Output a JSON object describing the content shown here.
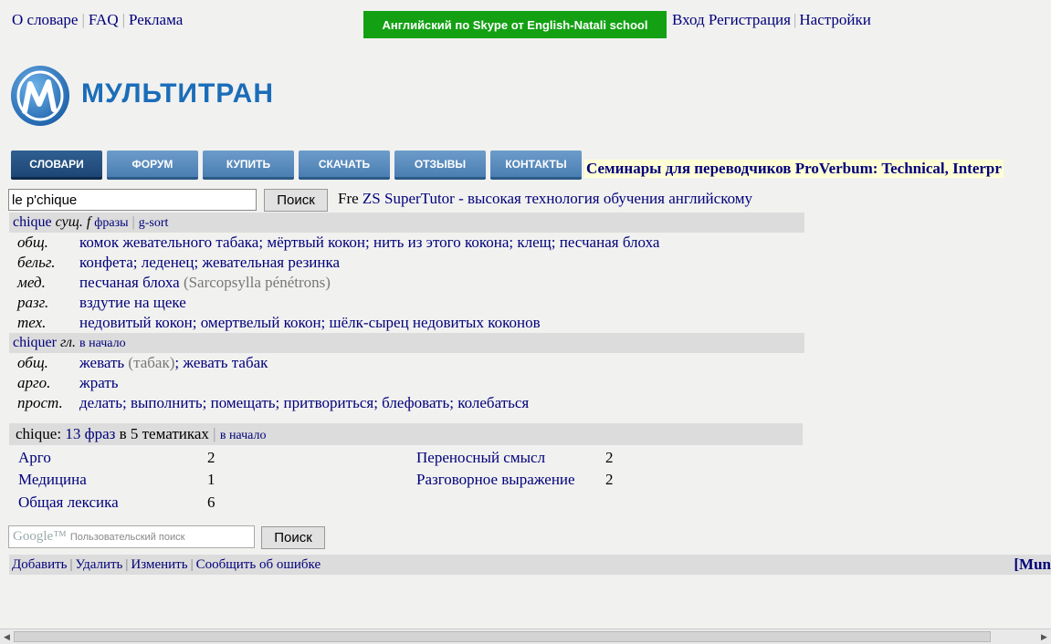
{
  "top_links": [
    "О словаре",
    "FAQ",
    "Реклама"
  ],
  "ad_banner": "Английский по Skype от English-Natali school",
  "account_links": [
    "Вход",
    "Регистрация",
    "Настройки"
  ],
  "logo_text": "МУЛЬТИТРАН",
  "nav": [
    "СЛОВАРИ",
    "ФОРУМ",
    "КУПИТЬ",
    "СКАЧАТЬ",
    "ОТЗЫВЫ",
    "КОНТАКТЫ"
  ],
  "seminar_text": "Семинары для переводчиков ProVerbum: Technical, Interpr",
  "search": {
    "value": "le p'chique",
    "button": "Поиск"
  },
  "promo": {
    "lang": "Fre",
    "text": "ZS SuperTutor - высокая технология обучения английскому"
  },
  "entries": [
    {
      "word": "chique",
      "pos": "сущ.",
      "gender": "f",
      "links": [
        "фразы",
        "g-sort"
      ],
      "rows": [
        {
          "subject": "общ.",
          "text": "комок жевательного табака; мёртвый кокон; нить из этого кокона; клещ; песчаная блоха",
          "note": ""
        },
        {
          "subject": "бельг.",
          "text": "конфета; леденец; жевательная резинка",
          "note": ""
        },
        {
          "subject": "мед.",
          "text": "песчаная блоха",
          "note": "(Sarcopsylla pénétrons)"
        },
        {
          "subject": "разг.",
          "text": "вздутие на щеке",
          "note": ""
        },
        {
          "subject": "тех.",
          "text": "недовитый кокон; омертвелый кокон; шёлк-сырец недовитых коконов",
          "note": ""
        }
      ]
    },
    {
      "word": "chiquer",
      "pos": "гл.",
      "gender": "",
      "links": [
        "в начало"
      ],
      "rows": [
        {
          "subject": "общ.",
          "text_a": "жевать",
          "note": "(табак)",
          "text_b": "; жевать табак"
        },
        {
          "subject": "арго.",
          "text": "жрать",
          "note": ""
        },
        {
          "subject": "прост.",
          "text": "делать; выполнить; помещать; притвориться; блефовать; колебаться",
          "note": ""
        }
      ]
    }
  ],
  "summary": {
    "word": "chique",
    "phrases_link": "13 фраз",
    "rest": "в 5 тематиках",
    "top_link": "в начало"
  },
  "topics": [
    {
      "name": "Арго",
      "count": "2"
    },
    {
      "name": "Медицина",
      "count": "1"
    },
    {
      "name": "Общая лексика",
      "count": "6"
    },
    {
      "name": "Переносный смысл",
      "count": "2"
    },
    {
      "name": "Разговорное выражение",
      "count": "2"
    }
  ],
  "google": {
    "logo": "Google™",
    "placeholder": "Пользовательский поиск",
    "button": "Поиск"
  },
  "footer": {
    "links": [
      "Добавить",
      "Удалить",
      "Изменить",
      "Сообщить об ошибке"
    ],
    "right": "[Mun"
  },
  "colors": {
    "link": "#00007a",
    "ad_green": "#13a113",
    "nav_blue": "#4a7eb3",
    "logo_blue": "#1b6db8",
    "row_gray": "#dcdcdc"
  }
}
